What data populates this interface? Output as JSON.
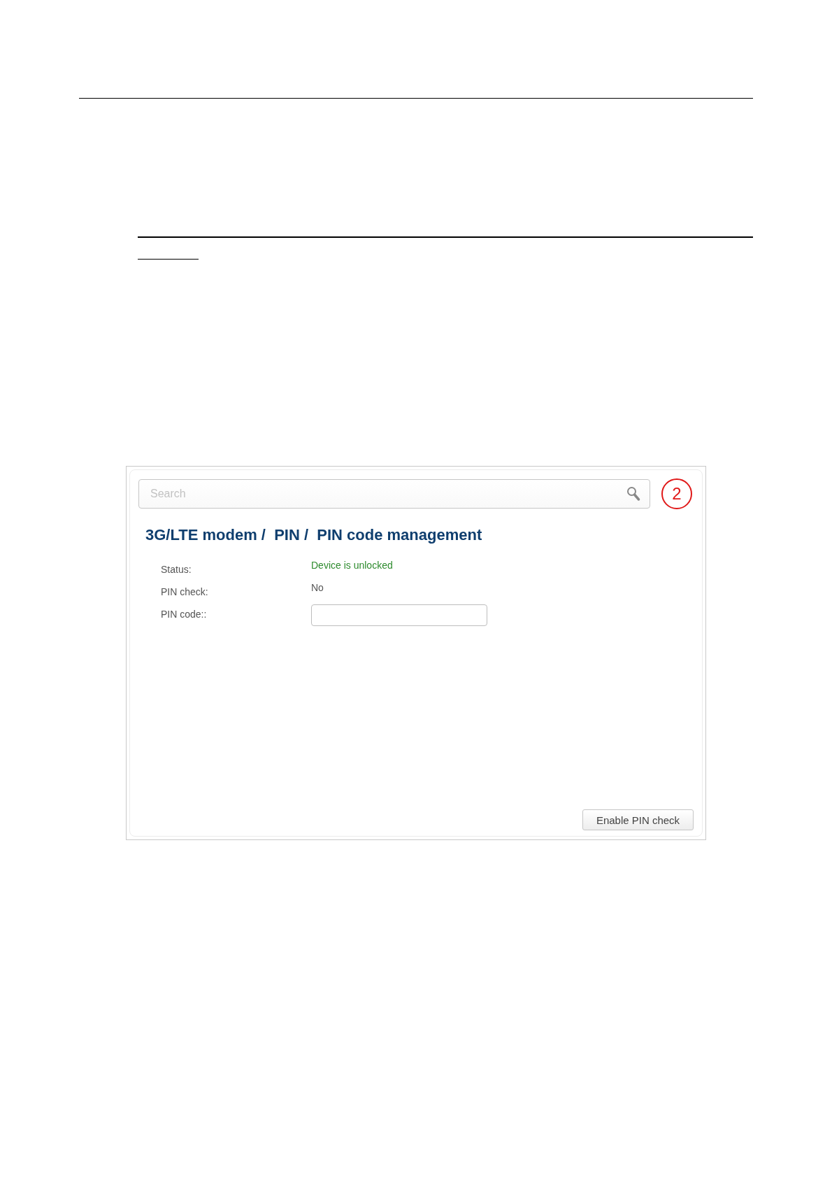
{
  "search": {
    "placeholder": "Search"
  },
  "callout": "2",
  "title": "3G/LTE modem /  PIN /  PIN code management",
  "fields": [
    {
      "kind": "text",
      "label": "Status:",
      "value": "Device is unlocked",
      "color": "#2e8b2e"
    },
    {
      "kind": "text",
      "label": "PIN check:",
      "value": "No",
      "color": "#555555"
    },
    {
      "kind": "input",
      "label": "PIN code::"
    }
  ],
  "button": "Enable PIN check"
}
